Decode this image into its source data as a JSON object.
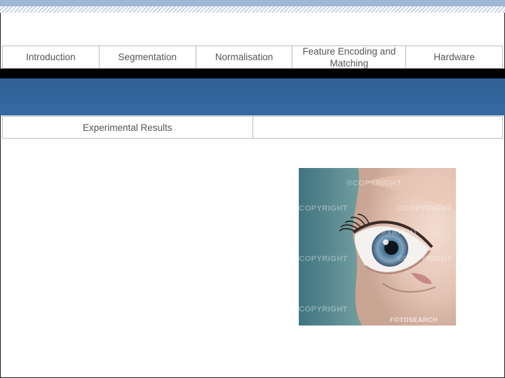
{
  "nav": {
    "items": [
      {
        "label": "Introduction"
      },
      {
        "label": "Segmentation"
      },
      {
        "label": "Normalisation"
      },
      {
        "label": "Feature Encoding and Matching"
      },
      {
        "label": "Hardware"
      }
    ]
  },
  "nav2": {
    "items": [
      {
        "label": "Experimental Results"
      },
      {
        "label": ""
      }
    ]
  },
  "photo": {
    "watermarks": [
      "©COPYRIGHT",
      "COPYRIGHT",
      "©COPYRIGHT",
      "COPYRIGHT",
      "COPYRIGHT",
      "©COPYRIGHT",
      "COPYRIGHT",
      "FOTOSEARCH"
    ]
  },
  "colors": {
    "accent_blue": "#356aa0",
    "top_band": "#9fb8d6"
  }
}
